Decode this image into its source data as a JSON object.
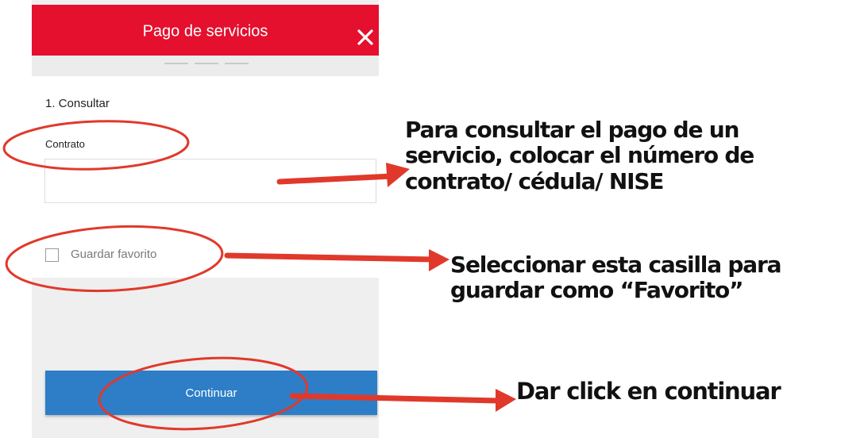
{
  "header": {
    "title": "Pago de servicios"
  },
  "form": {
    "section_title": "1. Consultar",
    "contract_label": "Contrato",
    "contract_value": "",
    "favorite_label": "Guardar favorito",
    "favorite_checked": false,
    "continue_label": "Continuar"
  },
  "annotations": {
    "contract_note": "Para consultar el pago de un servicio, colocar el número de contrato/ cédula/ NISE",
    "favorite_note": "Seleccionar esta casilla para guardar como “Favorito”",
    "continue_note": "Dar click en continuar"
  },
  "colors": {
    "header": "#e4102e",
    "button": "#2d7ec7",
    "annotation": "#e0392b"
  },
  "icons": {
    "close": "close-icon"
  }
}
